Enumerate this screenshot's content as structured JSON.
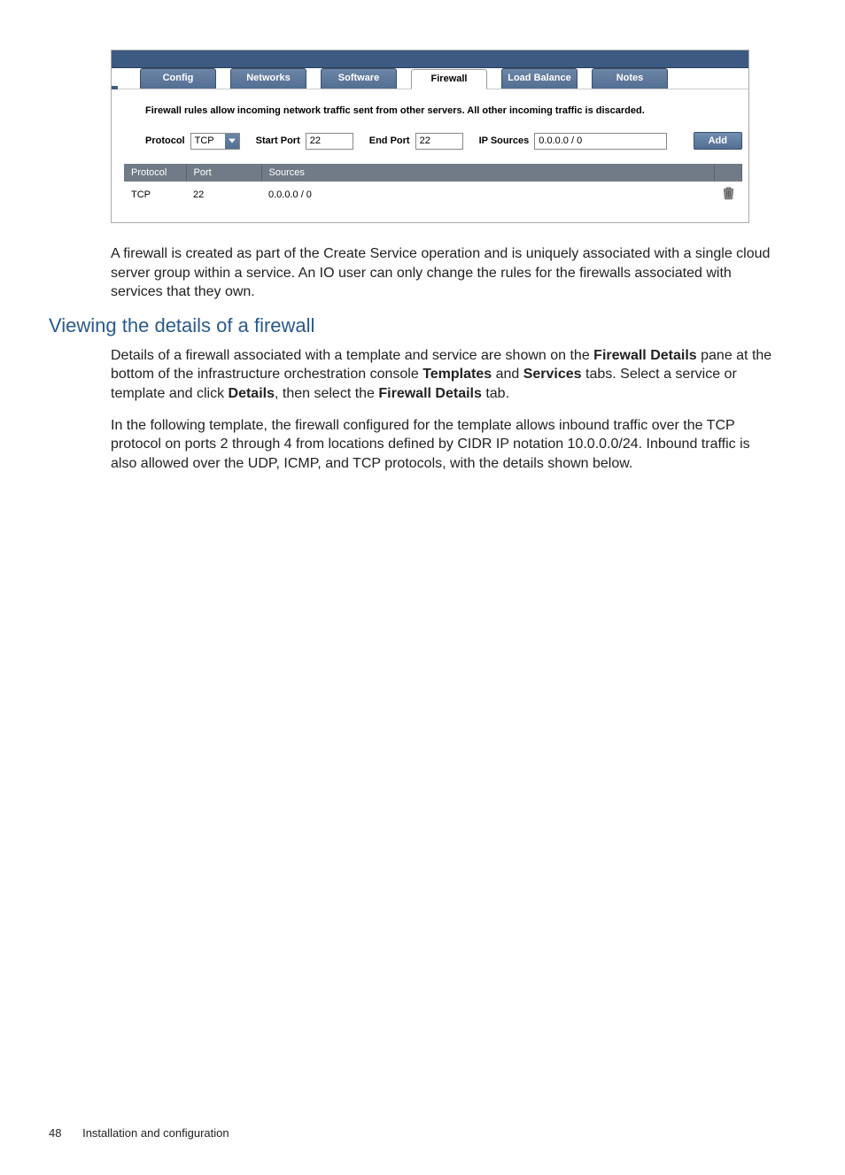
{
  "screenshot": {
    "tabs": [
      "Config",
      "Networks",
      "Software",
      "Firewall",
      "Load Balance",
      "Notes"
    ],
    "active_tab_index": 3,
    "description": "Firewall rules allow incoming network traffic sent from other servers.  All other incoming traffic is discarded.",
    "form": {
      "protocol_label": "Protocol",
      "protocol_value": "TCP",
      "start_port_label": "Start Port",
      "start_port_value": "22",
      "end_port_label": "End Port",
      "end_port_value": "22",
      "ip_sources_label": "IP Sources",
      "ip_sources_value": "0.0.0.0 / 0",
      "add_button": "Add"
    },
    "table": {
      "headers": [
        "Protocol",
        "Port",
        "Sources"
      ],
      "rows": [
        {
          "protocol": "TCP",
          "port": "22",
          "sources": "0.0.0.0 / 0"
        }
      ]
    }
  },
  "para1": "A firewall is created as part of the Create Service operation and is uniquely associated with a single cloud server group within a service. An IO user can only change the rules for the firewalls associated with services that they own.",
  "heading": "Viewing the details of a firewall",
  "para2_parts": {
    "a": "Details of a firewall associated with a template and service are shown on the ",
    "b": "Firewall Details",
    "c": " pane at the bottom of the infrastructure orchestration console ",
    "d": "Templates",
    "e": " and ",
    "f": "Services",
    "g": " tabs. Select a service or template and click ",
    "h": "Details",
    "i": ", then select the ",
    "j": "Firewall Details",
    "k": " tab."
  },
  "para3": "In the following template, the firewall configured for the template allows inbound traffic over the TCP protocol on ports 2 through 4 from locations defined by CIDR IP notation 10.0.0.0/24. Inbound traffic is also allowed over the UDP, ICMP, and TCP protocols, with the details shown below.",
  "footer": {
    "page_number": "48",
    "section": "Installation and configuration"
  }
}
